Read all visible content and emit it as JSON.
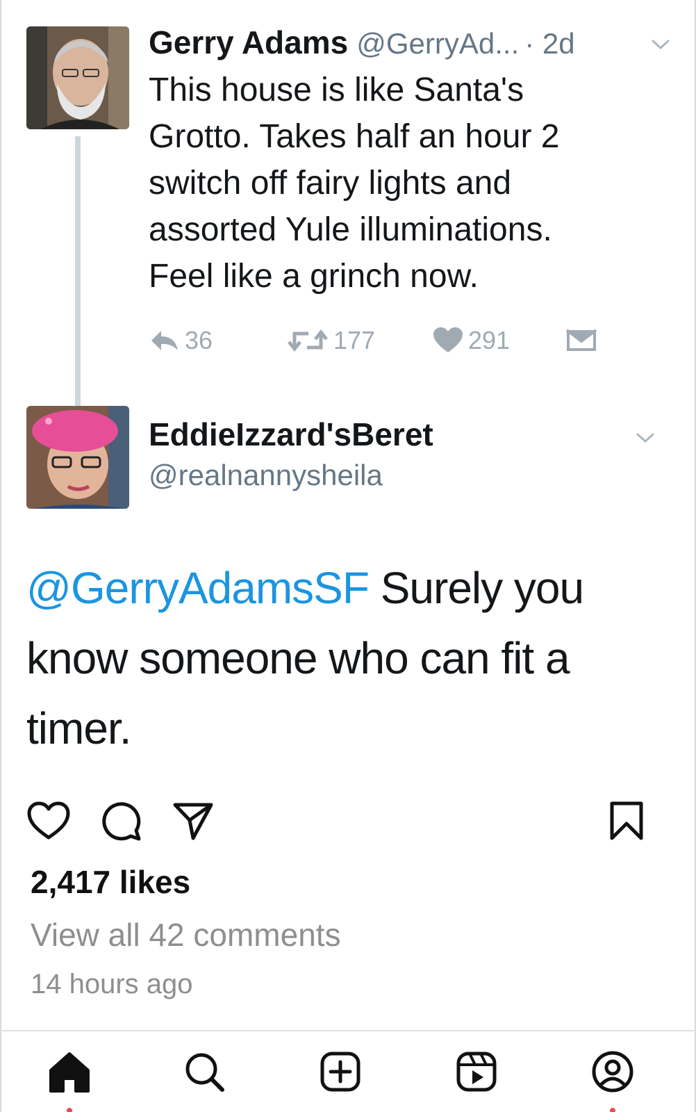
{
  "tweet1": {
    "author_name": "Gerry Adams",
    "handle": "@GerryAd...",
    "time": "· 2d",
    "lines": [
      "This house is like Santa's",
      "Grotto. Takes half an hour 2",
      "switch off fairy lights and",
      "assorted Yule illuminations.",
      "Feel like a grinch now."
    ],
    "replies": "36",
    "retweets": "177",
    "likes": "291"
  },
  "tweet2": {
    "author_name": "EddieIzzard'sBeret",
    "handle": "@realnannysheila",
    "mention": "@GerryAdamsSF",
    "line1_rest": " Surely you",
    "line2": "know someone who can fit a",
    "line3": "timer."
  },
  "post": {
    "likes": "2,417 likes",
    "comments_link": "View all 42 comments",
    "time": "14 hours ago"
  },
  "icons": {
    "tweet_actions": [
      "reply-icon",
      "retweet-icon",
      "heart-icon",
      "envelope-icon"
    ],
    "post_actions": [
      "heart-icon",
      "comment-icon",
      "send-icon",
      "bookmark-icon"
    ],
    "bottom_nav": [
      "home-icon",
      "search-icon",
      "create-icon",
      "reels-icon",
      "profile-icon"
    ]
  },
  "colors": {
    "mention": "#1b95e0",
    "tweet_meta": "#657786",
    "tweet_action": "#a0aab3",
    "thread_line": "#ccd6dd",
    "notification_dot": "#ed4956",
    "secondary_text": "#8e8e8e"
  }
}
